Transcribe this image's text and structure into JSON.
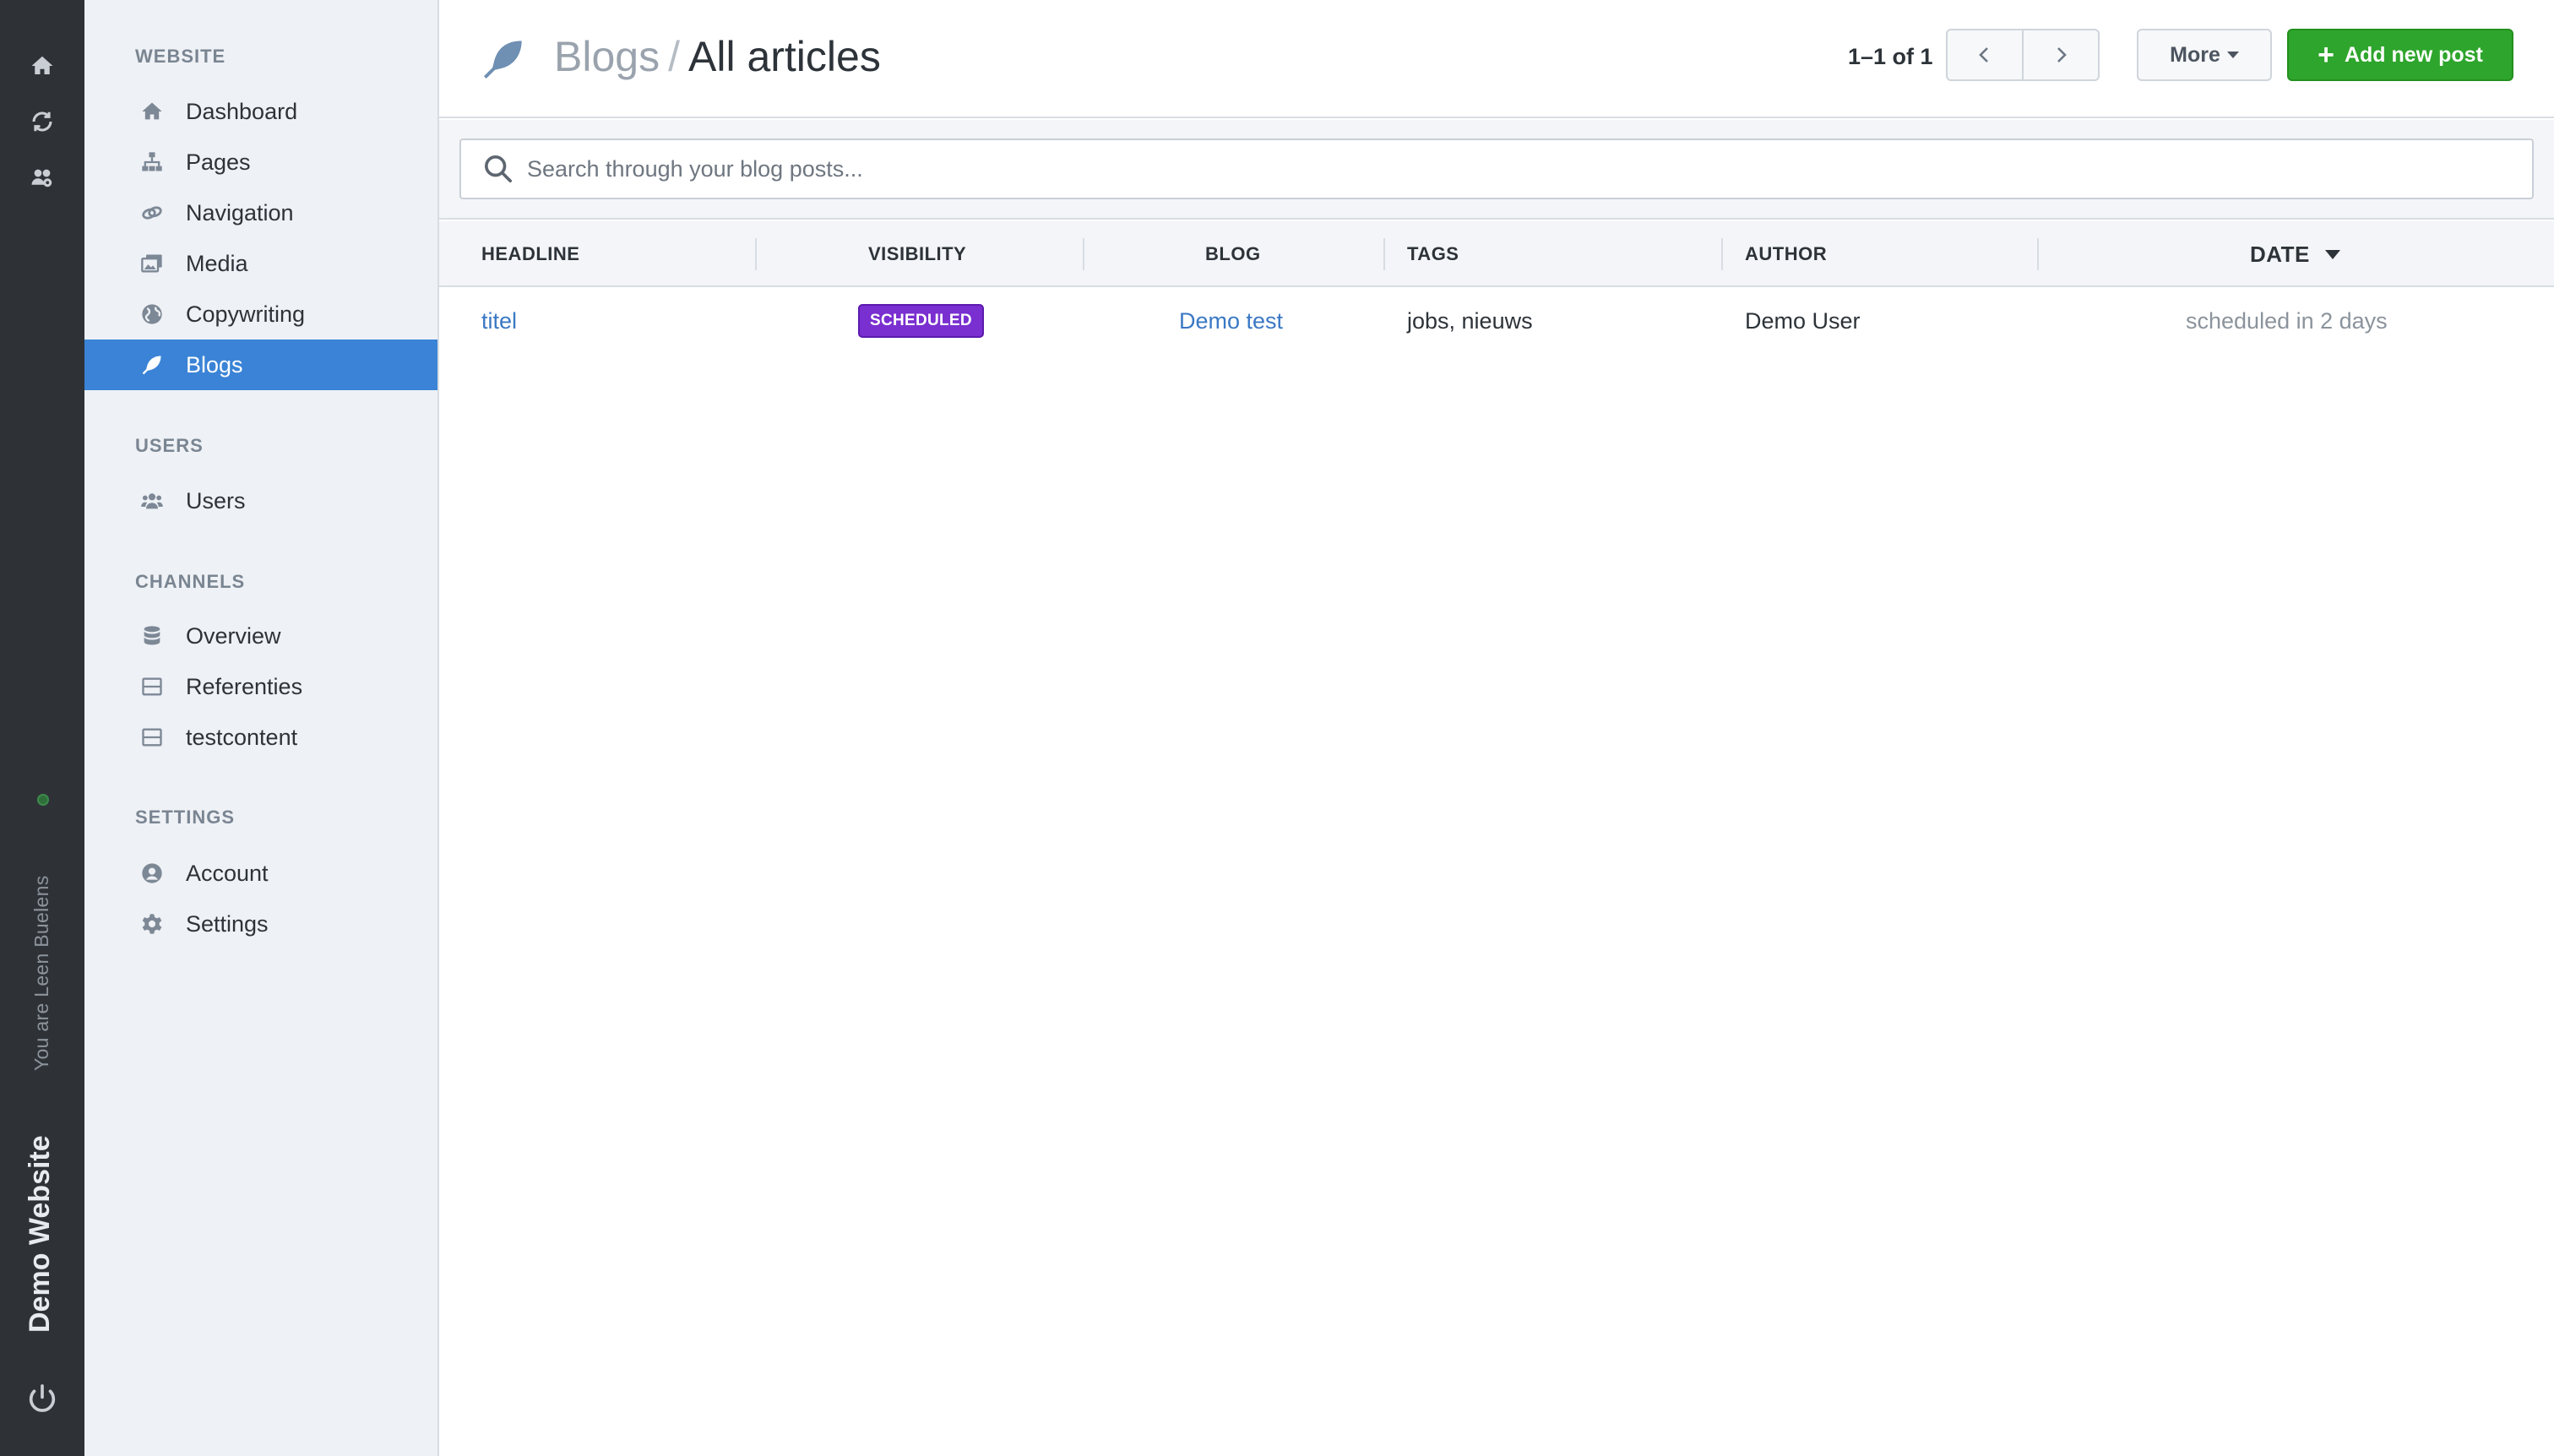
{
  "rail": {
    "icons": [
      "home-icon",
      "sync-icon",
      "users-cog-icon"
    ],
    "user_text": "You are Leen Buelens",
    "site_name": "Demo Website",
    "status_color": "#2f6e3b"
  },
  "sidebar": {
    "sections": [
      {
        "title": "WEBSITE",
        "items": [
          {
            "label": "Dashboard",
            "icon": "home-icon"
          },
          {
            "label": "Pages",
            "icon": "sitemap-icon"
          },
          {
            "label": "Navigation",
            "icon": "link-icon"
          },
          {
            "label": "Media",
            "icon": "images-icon"
          },
          {
            "label": "Copywriting",
            "icon": "globe-icon"
          },
          {
            "label": "Blogs",
            "icon": "feather-icon",
            "active": true
          }
        ]
      },
      {
        "title": "USERS",
        "items": [
          {
            "label": "Users",
            "icon": "users-icon"
          }
        ]
      },
      {
        "title": "CHANNELS",
        "items": [
          {
            "label": "Overview",
            "icon": "database-icon"
          },
          {
            "label": "Referenties",
            "icon": "table-icon"
          },
          {
            "label": "testcontent",
            "icon": "table-icon"
          }
        ]
      },
      {
        "title": "SETTINGS",
        "items": [
          {
            "label": "Account",
            "icon": "user-circle-icon"
          },
          {
            "label": "Settings",
            "icon": "gear-icon"
          }
        ]
      }
    ]
  },
  "header": {
    "breadcrumb_parent": "Blogs",
    "breadcrumb_sep": "/",
    "breadcrumb_current": "All articles",
    "pager_text": "1–1 of 1",
    "more_label": "More",
    "add_label": "Add new post",
    "accent": "#2ea52c"
  },
  "search": {
    "placeholder": "Search through your blog posts..."
  },
  "table": {
    "columns": [
      "HEADLINE",
      "VISIBILITY",
      "BLOG",
      "TAGS",
      "AUTHOR",
      "DATE"
    ],
    "rows": [
      {
        "headline": "titel",
        "visibility": "SCHEDULED",
        "blog": "Demo test",
        "tags": "jobs, nieuws",
        "author": "Demo User",
        "date": "scheduled in 2 days"
      }
    ]
  }
}
